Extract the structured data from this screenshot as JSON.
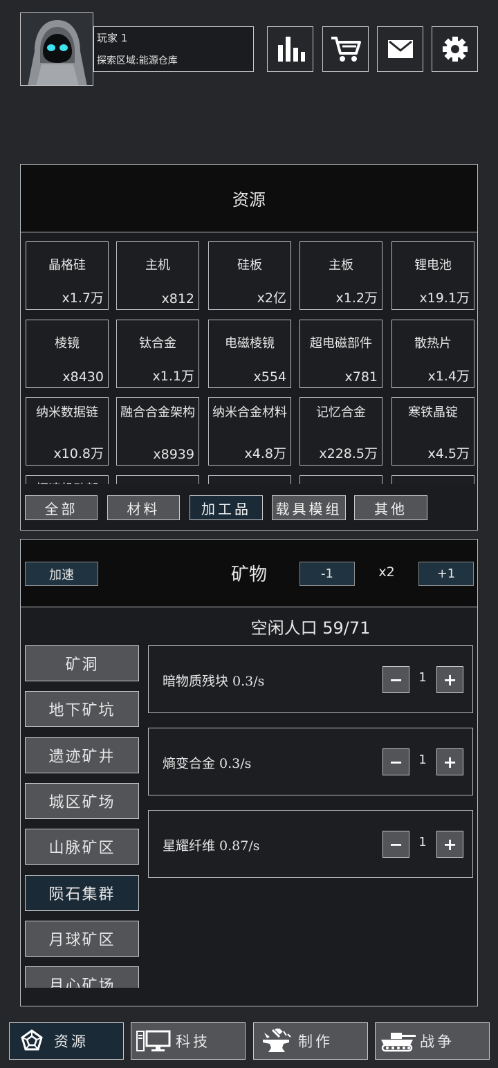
{
  "player": {
    "name": "玩家 1",
    "zone": "探索区域:能源仓库"
  },
  "header_buttons": [
    "stats-icon",
    "cart-icon",
    "mail-icon",
    "gear-icon"
  ],
  "resources": {
    "title": "资源",
    "items": [
      {
        "name": "晶格硅",
        "count": "x1.7万"
      },
      {
        "name": "主机",
        "count": "x812"
      },
      {
        "name": "硅板",
        "count": "x2亿"
      },
      {
        "name": "主板",
        "count": "x1.2万"
      },
      {
        "name": "锂电池",
        "count": "x19.1万"
      },
      {
        "name": "棱镜",
        "count": "x8430"
      },
      {
        "name": "钛合金",
        "count": "x1.1万"
      },
      {
        "name": "电磁棱镜",
        "count": "x554"
      },
      {
        "name": "超电磁部件",
        "count": "x781"
      },
      {
        "name": "散热片",
        "count": "x1.4万"
      },
      {
        "name": "纳米数据链",
        "count": "x10.8万"
      },
      {
        "name": "融合合金架构",
        "count": "x8939"
      },
      {
        "name": "纳米合金材料",
        "count": "x4.8万"
      },
      {
        "name": "记忆合金",
        "count": "x228.5万"
      },
      {
        "name": "寒铁晶锭",
        "count": "x4.5万"
      },
      {
        "name": "恒速机动部",
        "count": ""
      },
      {
        "name": "",
        "count": ""
      },
      {
        "name": "",
        "count": ""
      },
      {
        "name": "",
        "count": ""
      },
      {
        "name": "",
        "count": ""
      }
    ],
    "filters": [
      "全部",
      "材料",
      "加工品",
      "载具模组",
      "其他"
    ],
    "active_filter": 2
  },
  "mining": {
    "boost_label": "加速",
    "title": "矿物",
    "minus_label": "-1",
    "multiplier": "x2",
    "plus_label": "+1",
    "population": "空闲人口 59/71",
    "sites": [
      "矿洞",
      "地下矿坑",
      "遗迹矿井",
      "城区矿场",
      "山脉矿区",
      "陨石集群",
      "月球矿区",
      "月心矿场"
    ],
    "active_site": 5,
    "rows": [
      {
        "text": "暗物质残块  0.3/s",
        "qty": "1"
      },
      {
        "text": "熵变合金  0.3/s",
        "qty": "1"
      },
      {
        "text": "星耀纤维  0.87/s",
        "qty": "1"
      }
    ],
    "dec_symbol": "−",
    "inc_symbol": "+"
  },
  "nav": [
    {
      "label": "资源",
      "icon": "dodecahedron-icon"
    },
    {
      "label": "科技",
      "icon": "computer-icon"
    },
    {
      "label": "制作",
      "icon": "anvil-icon"
    },
    {
      "label": "战争",
      "icon": "tank-icon"
    }
  ],
  "active_nav": 0
}
